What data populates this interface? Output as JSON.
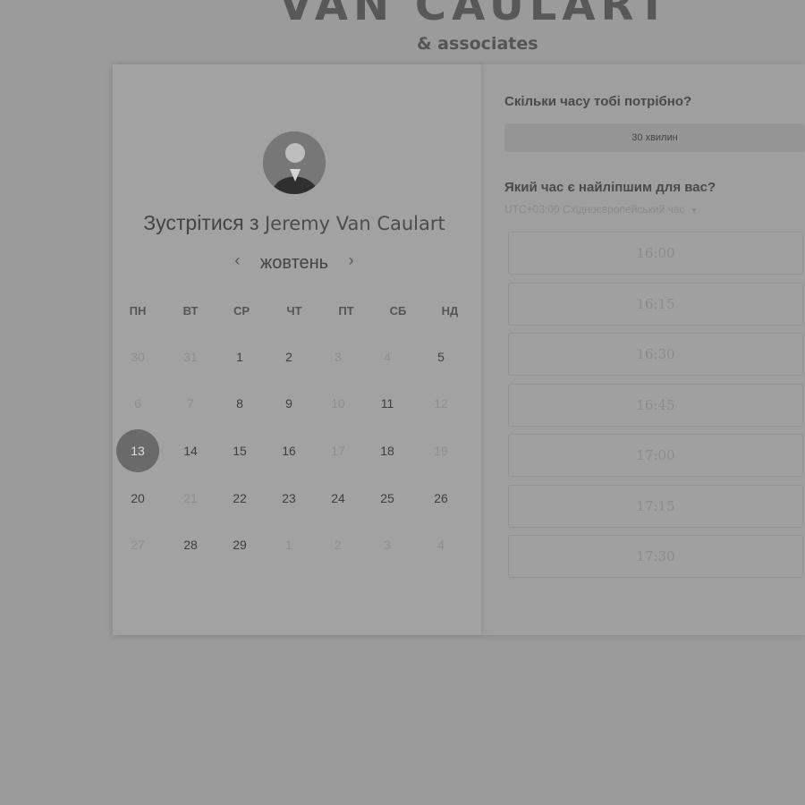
{
  "brand": {
    "title": "VAN CAULART",
    "subtitle": "& associates"
  },
  "calendar": {
    "title_prefix": "Зустрітися з",
    "host_name": "Jeremy Van Caulart",
    "month": "жовтень",
    "prev_icon": "chevron-left-icon",
    "next_icon": "chevron-right-icon",
    "weekdays": [
      "ПН",
      "ВТ",
      "СР",
      "ЧТ",
      "ПТ",
      "СБ",
      "НД"
    ],
    "days": [
      [
        "30",
        "31",
        "1",
        "2",
        "3",
        "4",
        "5"
      ],
      [
        "6",
        "7",
        "8",
        "9",
        "10",
        "11",
        "12"
      ],
      [
        "13",
        "14",
        "15",
        "16",
        "17",
        "18",
        "19"
      ],
      [
        "20",
        "21",
        "22",
        "23",
        "24",
        "25",
        "26"
      ],
      [
        "27",
        "28",
        "29",
        "1",
        "2",
        "3",
        "4"
      ]
    ],
    "muted": [
      [
        true,
        true,
        false,
        false,
        true,
        true,
        false
      ],
      [
        true,
        true,
        false,
        false,
        true,
        false,
        true
      ],
      [
        false,
        false,
        false,
        false,
        true,
        false,
        true
      ],
      [
        false,
        true,
        false,
        false,
        false,
        false,
        false
      ],
      [
        true,
        false,
        false,
        true,
        true,
        true,
        true
      ]
    ],
    "selected_day": "13"
  },
  "booking": {
    "duration_question": "Скільки часу тобі потрібно?",
    "duration_value": "30 хвилин",
    "time_question": "Який час є найліпшим для вас?",
    "timezone": "UTC+03:00 Східноєвропейський час",
    "slots": [
      "16:00",
      "16:15",
      "16:30",
      "16:45",
      "17:00",
      "17:15",
      "17:30"
    ]
  },
  "colors": {
    "background": "#9b9b9b",
    "selected_day": "#6a6a6a"
  }
}
